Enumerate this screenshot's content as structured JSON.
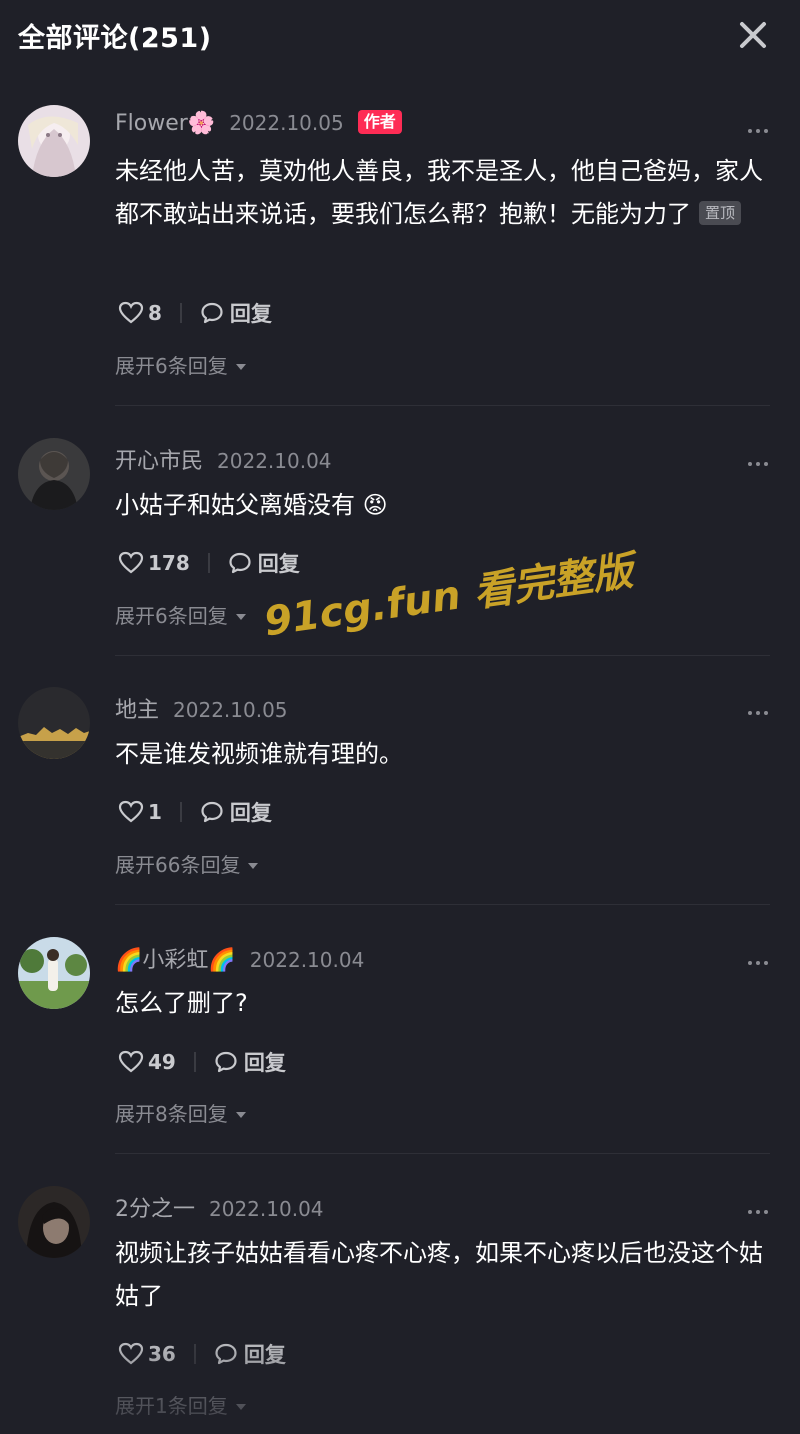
{
  "header": {
    "title": "全部评论(251)"
  },
  "comments": [
    {
      "user": "Flower🌸",
      "date": "2022.10.05",
      "badge": "作者",
      "text": "未经他人苦，莫劝他人善良，我不是圣人，他自己爸妈，家人都不敢站出来说话，要我们怎么帮？抱歉！无能为力了",
      "pinned": "置顶",
      "likes": "8",
      "reply_label": "回复",
      "expand": "展开6条回复"
    },
    {
      "user": "开心市民",
      "date": "2022.10.04",
      "text": "小姑子和姑父离婚没有 😡",
      "likes": "178",
      "reply_label": "回复",
      "expand": "展开6条回复"
    },
    {
      "user": "地主",
      "date": "2022.10.05",
      "text": "不是谁发视频谁就有理的。",
      "likes": "1",
      "reply_label": "回复",
      "expand": "展开66条回复"
    },
    {
      "user": "🌈小彩虹🌈",
      "date": "2022.10.04",
      "text": "怎么了删了?",
      "likes": "49",
      "reply_label": "回复",
      "expand": "展开8条回复"
    },
    {
      "user": "2分之一",
      "date": "2022.10.04",
      "text": "视频让孩子姑姑看看心疼不心疼，如果不心疼以后也没这个姑姑了",
      "likes": "36",
      "reply_label": "回复",
      "expand": "展开1条回复"
    }
  ],
  "watermark": "91cg.fun 看完整版",
  "icons": {
    "close": "close-icon",
    "like": "heart-outline-icon",
    "reply": "speech-bubble-icon",
    "more": "more-dots-icon"
  },
  "colors": {
    "background": "#1f2028",
    "author_badge": "#fe2c55",
    "watermark": "#c9a227"
  }
}
